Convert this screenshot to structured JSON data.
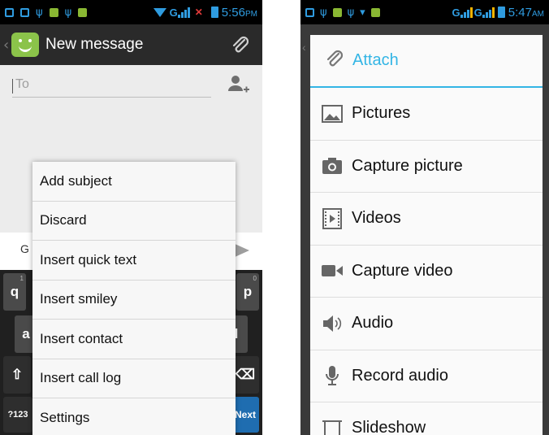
{
  "left": {
    "status": {
      "time": "5:56",
      "ampm": "PM",
      "network": "G"
    },
    "header": {
      "title": "New message"
    },
    "compose": {
      "to_placeholder": "To",
      "message_hint": "G"
    },
    "keyboard": {
      "row1_left": "q",
      "row1_left_hint": "1",
      "row1_right": "p",
      "row1_right_hint": "0",
      "row2_left": "a",
      "row2_right": "l",
      "sym": "?123",
      "next": "Next",
      "delete": "⌫",
      "shift": "⇧"
    },
    "menu": [
      "Add subject",
      "Discard",
      "Insert quick text",
      "Insert smiley",
      "Insert contact",
      "Insert call log",
      "Settings"
    ]
  },
  "right": {
    "status": {
      "time": "5:47",
      "ampm": "AM",
      "network": "G",
      "network2": "G"
    },
    "dialog": {
      "title": "Attach",
      "options": [
        {
          "label": "Pictures",
          "icon": "picture-icon"
        },
        {
          "label": "Capture picture",
          "icon": "camera-icon"
        },
        {
          "label": "Videos",
          "icon": "video-file-icon"
        },
        {
          "label": "Capture video",
          "icon": "video-camera-icon"
        },
        {
          "label": "Audio",
          "icon": "speaker-icon"
        },
        {
          "label": "Record audio",
          "icon": "microphone-icon"
        },
        {
          "label": "Slideshow",
          "icon": "slideshow-icon"
        }
      ]
    }
  },
  "colors": {
    "accent": "#33b5e5",
    "status_blue": "#2f9ce0",
    "action_bar": "#2a2a2a",
    "keyboard": "#202020",
    "emoji_green": "#8bc34a"
  }
}
